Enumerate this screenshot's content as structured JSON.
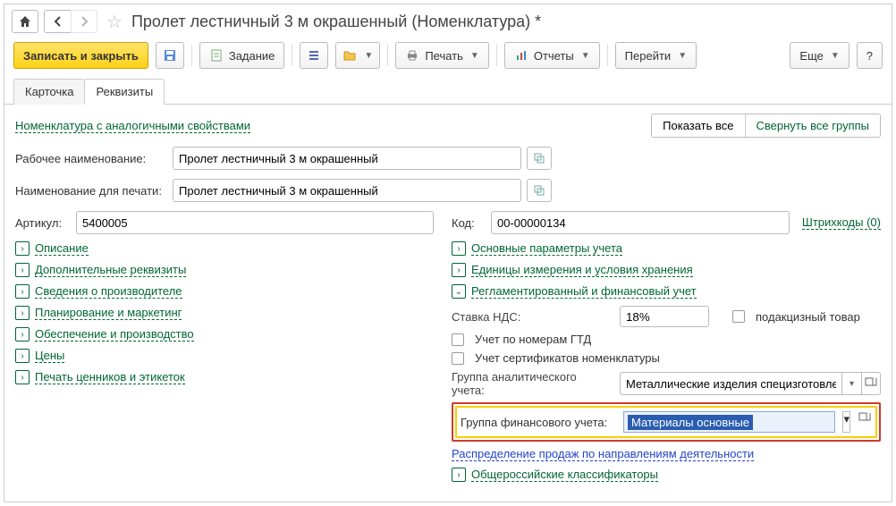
{
  "title": "Пролет лестничный 3 м окрашенный (Номенклатура) *",
  "toolbar": {
    "save_close": "Записать и закрыть",
    "task": "Задание",
    "print": "Печать",
    "reports": "Отчеты",
    "goto": "Перейти",
    "more": "Еще",
    "help": "?"
  },
  "tabs": {
    "card": "Карточка",
    "props": "Реквизиты"
  },
  "links": {
    "similar": "Номенклатура с аналогичными свойствами",
    "show_all": "Показать все",
    "collapse_all": "Свернуть все группы",
    "barcodes": "Штрихкоды (0)",
    "distribution": "Распределение продаж по направлениям деятельности"
  },
  "fields": {
    "work_name_lbl": "Рабочее наименование:",
    "work_name_val": "Пролет лестничный 3 м окрашенный",
    "print_name_lbl": "Наименование для печати:",
    "print_name_val": "Пролет лестничный 3 м окрашенный",
    "article_lbl": "Артикул:",
    "article_val": "5400005",
    "code_lbl": "Код:",
    "code_val": "00-00000134"
  },
  "sections_left": [
    "Описание",
    "Дополнительные реквизиты",
    "Сведения о производителе",
    "Планирование и маркетинг",
    "Обеспечение и производство",
    "Цены",
    "Печать ценников и этикеток"
  ],
  "sections_right": {
    "main_params": "Основные параметры учета",
    "units": "Единицы измерения и условия хранения",
    "reg_fin": "Регламентированный и финансовый учет",
    "classifiers": "Общероссийские классификаторы"
  },
  "reg_fin_panel": {
    "vat_lbl": "Ставка НДС:",
    "vat_val": "18%",
    "excise_lbl": "подакцизный товар",
    "gtd_lbl": "Учет по номерам ГТД",
    "cert_lbl": "Учет сертификатов номенклатуры",
    "analytic_lbl": "Группа аналитического учета:",
    "analytic_val": "Металлические изделия специзготовлени",
    "fin_group_lbl": "Группа финансового учета:",
    "fin_group_val": "Материалы основные"
  }
}
